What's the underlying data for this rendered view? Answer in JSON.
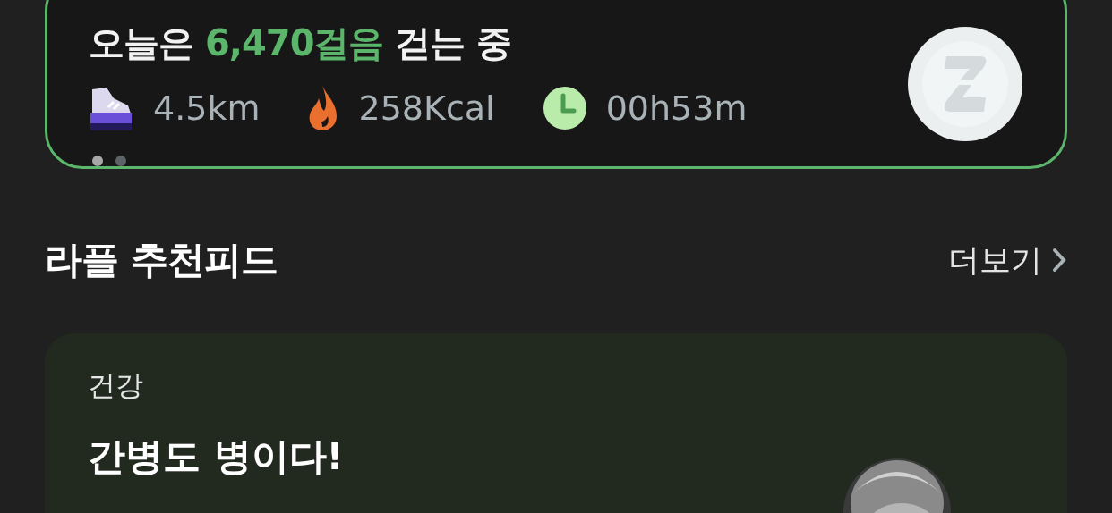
{
  "summary": {
    "title_before": "오늘은",
    "steps": "6,470걸음",
    "title_after": "걷는 중",
    "stats": [
      {
        "kind": "distance",
        "value": "4.5km"
      },
      {
        "kind": "calories",
        "value": "258Kcal"
      },
      {
        "kind": "time",
        "value": "00h53m"
      }
    ],
    "page_dots": [
      {
        "selected": true
      },
      {
        "selected": false
      }
    ]
  },
  "feed": {
    "title": "라플 추천피드",
    "more": "더보기"
  },
  "feed_card": {
    "category": "건강",
    "headline": "간병도 병이다!"
  }
}
